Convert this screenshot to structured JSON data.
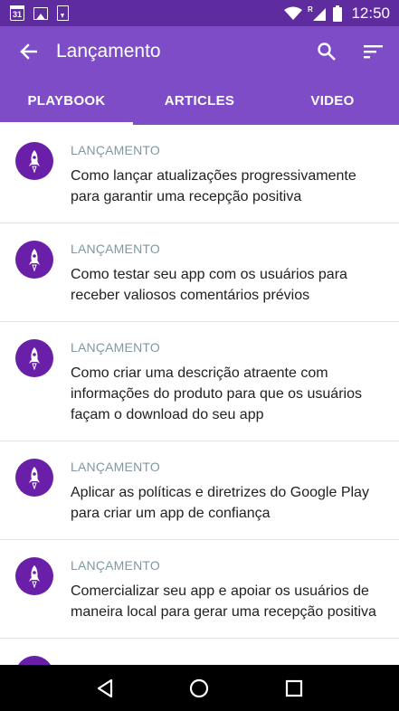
{
  "status_bar": {
    "calendar_day": "31",
    "time": "12:50",
    "left_icons": [
      "calendar-icon",
      "image-icon",
      "download-icon"
    ],
    "right_icons": [
      "wifi-icon",
      "signal-icon",
      "battery-icon"
    ]
  },
  "app_bar": {
    "title": "Lançamento",
    "back_icon": "arrow-back-icon",
    "actions": [
      "search-icon",
      "sort-icon"
    ],
    "color": "#7e4cc7"
  },
  "tabs": [
    {
      "label": "PLAYBOOK",
      "active": true
    },
    {
      "label": "ARTICLES",
      "active": false
    },
    {
      "label": "VIDEO",
      "active": false
    }
  ],
  "items": [
    {
      "category": "LANÇAMENTO",
      "title": "Como lançar atualizações progressivamente para garantir uma recepção positiva",
      "icon": "rocket-icon"
    },
    {
      "category": "LANÇAMENTO",
      "title": "Como testar seu app com os usuários para receber valiosos comentários prévios",
      "icon": "rocket-icon"
    },
    {
      "category": "LANÇAMENTO",
      "title": "Como criar uma descrição atraente com informações do produto para que os usuários façam o download do seu app",
      "icon": "rocket-icon"
    },
    {
      "category": "LANÇAMENTO",
      "title": "Aplicar as políticas e diretrizes do Google Play para criar um app de confiança",
      "icon": "rocket-icon"
    },
    {
      "category": "LANÇAMENTO",
      "title": "Comercializar seu app e apoiar os usuários de maneira local para gerar uma recepção positiva",
      "icon": "rocket-icon"
    },
    {
      "category": "",
      "title": "",
      "icon": "rocket-icon"
    }
  ],
  "nav_bar": [
    "back-nav-icon",
    "home-nav-icon",
    "recents-nav-icon"
  ]
}
